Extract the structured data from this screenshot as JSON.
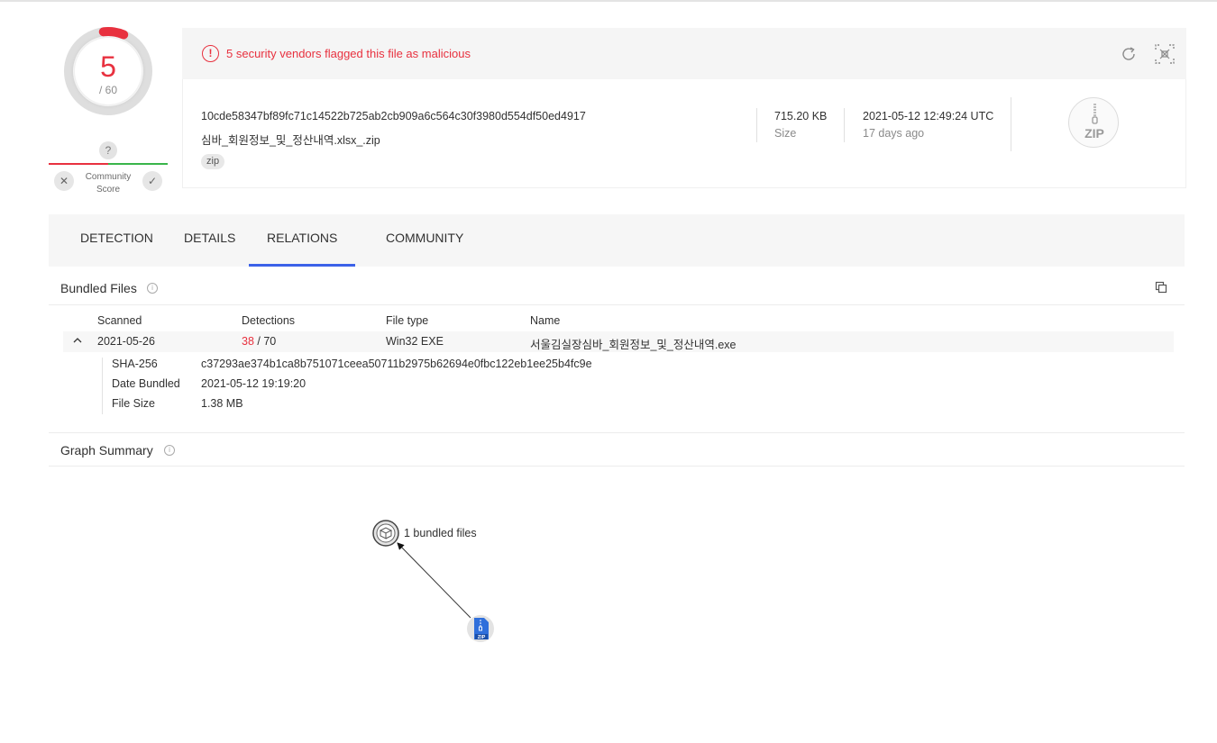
{
  "score": {
    "value": "5",
    "total": "/ 60",
    "color": "#e8313f",
    "fraction_flagged": 0.083
  },
  "community": {
    "question": "?",
    "label_line1": "Community",
    "label_line2": "Score",
    "dislike": "✕",
    "like": "✓"
  },
  "alert": {
    "icon": "!",
    "text": "5 security vendors flagged this file as malicious"
  },
  "file": {
    "hash": "10cde58347bf89fc71c14522b725ab2cb909a6c564c30f3980d554df50ed4917",
    "name": "심바_회원정보_및_정산내역.xlsx_.zip",
    "tag": "zip",
    "size_value": "715.20 KB",
    "size_label": "Size",
    "date_value": "2021-05-12 12:49:24 UTC",
    "date_label": "17 days ago",
    "badge": "ZIP"
  },
  "tabs": [
    "DETECTION",
    "DETAILS",
    "RELATIONS",
    "COMMUNITY"
  ],
  "active_tab": "RELATIONS",
  "bundled": {
    "title": "Bundled Files",
    "columns": [
      "Scanned",
      "Detections",
      "File type",
      "Name"
    ],
    "row": {
      "scanned": "2021-05-26",
      "detections_bad": "38",
      "detections_total": " / 70",
      "file_type": "Win32 EXE",
      "name": "서울김실장심바_회원정보_및_정산내역.exe"
    },
    "details": [
      {
        "label": "SHA-256",
        "value": "c37293ae374b1ca8b751071ceea50711b2975b62694e0fbc122eb1ee25b4fc9e"
      },
      {
        "label": "Date Bundled",
        "value": "2021-05-12 19:19:20"
      },
      {
        "label": "File Size",
        "value": "1.38 MB"
      }
    ]
  },
  "graph": {
    "title": "Graph Summary",
    "node_label": "1 bundled files",
    "file_badge": "ZIP"
  },
  "colors": {
    "accent": "#3b61e8",
    "malicious": "#e8313f",
    "harmless": "#39b54a"
  }
}
